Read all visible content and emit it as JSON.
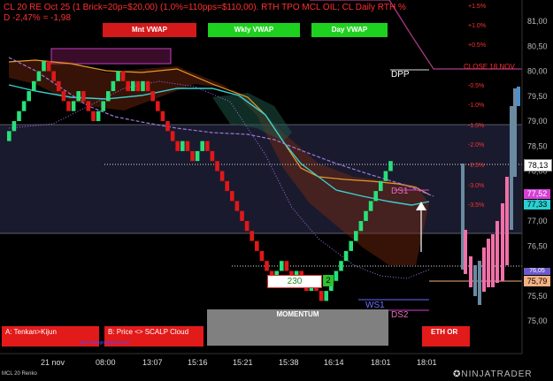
{
  "header": {
    "line1": "CL 20 RE Oct 25 (1 Brick=20p=$20,00)  (1,0%=110pps=$110,00). RTH TPO MCL OIL; CL Daily RTH %",
    "line2": "D -2,47% = -1,98"
  },
  "vwap_buttons": [
    {
      "label": "Mnt VWAP",
      "color": "#d31919"
    },
    {
      "label": "Wkly VWAP",
      "color": "#1ed11e"
    },
    {
      "label": "Day VWAP",
      "color": "#1ed11e"
    }
  ],
  "pct_labels": [
    "+1.5%",
    "+1.0%",
    "+0.5%",
    "-0.5%",
    "-1.0%",
    "-1.5%",
    "-2.0%",
    "-2.5%",
    "-3.0%",
    "-3.5%"
  ],
  "price_ticks": [
    "81,00",
    "80,50",
    "80,00",
    "79,50",
    "79,00",
    "78,50",
    "78,00",
    "77,50",
    "77,00",
    "76,50",
    "76,00",
    "75,50",
    "75,00"
  ],
  "price_flags": [
    {
      "label": "78,13",
      "bg": "#ffffff",
      "fg": "#000000"
    },
    {
      "label": "77,52",
      "bg": "#d63fd6",
      "fg": "#ffffff"
    },
    {
      "label": "77,33",
      "bg": "#29d1d1",
      "fg": "#000000"
    },
    {
      "label": "76,05",
      "bg": "#6a5acd",
      "fg": "#ffffff"
    },
    {
      "label": "75,79",
      "bg": "#f4b183",
      "fg": "#000000"
    }
  ],
  "levels": {
    "dpp": "DPP",
    "close": "CLOSE 18 NOV",
    "ds1": "DS1",
    "ws1": "WS1",
    "ds2": "DS2"
  },
  "counter": {
    "value": "230",
    "badge": "2"
  },
  "momentum_label": "MOMENTUM",
  "bottom_buttons": [
    {
      "label": "A: Tenkan>Kijun"
    },
    {
      "label": "B: Price <> SCALP Cloud"
    },
    {
      "label": "ETH OR"
    }
  ],
  "small_text": "Mail: bellogie@gmail.com",
  "x_ticks": [
    "21 nov",
    "08:00",
    "13:07",
    "15:16",
    "15:21",
    "15:38",
    "16:14",
    "18:01",
    "18:01"
  ],
  "footer": {
    "instrument": "MCL 20 Renko",
    "brand": "NINJATRADER"
  },
  "chart_data": {
    "type": "renko",
    "brick_size": 0.2,
    "ylim": [
      75.0,
      81.2
    ],
    "bricks": [
      {
        "o": 78.6,
        "c": 78.8
      },
      {
        "o": 78.8,
        "c": 79.0
      },
      {
        "o": 79.0,
        "c": 79.2
      },
      {
        "o": 79.2,
        "c": 79.4
      },
      {
        "o": 79.4,
        "c": 79.6
      },
      {
        "o": 79.6,
        "c": 79.8
      },
      {
        "o": 79.8,
        "c": 80.0
      },
      {
        "o": 80.0,
        "c": 80.2
      },
      {
        "o": 80.2,
        "c": 80.0
      },
      {
        "o": 80.0,
        "c": 79.8
      },
      {
        "o": 79.8,
        "c": 79.6
      },
      {
        "o": 79.6,
        "c": 79.4
      },
      {
        "o": 79.4,
        "c": 79.2
      },
      {
        "o": 79.2,
        "c": 79.4
      },
      {
        "o": 79.4,
        "c": 79.6
      },
      {
        "o": 79.6,
        "c": 79.4
      },
      {
        "o": 79.4,
        "c": 79.2
      },
      {
        "o": 79.2,
        "c": 79.0
      },
      {
        "o": 79.0,
        "c": 79.2
      },
      {
        "o": 79.2,
        "c": 79.4
      },
      {
        "o": 79.4,
        "c": 79.6
      },
      {
        "o": 79.6,
        "c": 79.8
      },
      {
        "o": 79.8,
        "c": 80.0
      },
      {
        "o": 80.0,
        "c": 79.8
      },
      {
        "o": 79.8,
        "c": 79.6
      },
      {
        "o": 79.6,
        "c": 79.8
      },
      {
        "o": 79.8,
        "c": 79.6
      },
      {
        "o": 79.6,
        "c": 79.8
      },
      {
        "o": 79.8,
        "c": 79.6
      },
      {
        "o": 79.6,
        "c": 79.4
      },
      {
        "o": 79.4,
        "c": 79.2
      },
      {
        "o": 79.2,
        "c": 79.0
      },
      {
        "o": 79.0,
        "c": 78.8
      },
      {
        "o": 78.8,
        "c": 78.6
      },
      {
        "o": 78.6,
        "c": 78.4
      },
      {
        "o": 78.4,
        "c": 78.6
      },
      {
        "o": 78.6,
        "c": 78.4
      },
      {
        "o": 78.4,
        "c": 78.2
      },
      {
        "o": 78.2,
        "c": 78.4
      },
      {
        "o": 78.4,
        "c": 78.6
      },
      {
        "o": 78.6,
        "c": 78.4
      },
      {
        "o": 78.4,
        "c": 78.2
      },
      {
        "o": 78.2,
        "c": 78.0
      },
      {
        "o": 78.0,
        "c": 77.8
      },
      {
        "o": 77.8,
        "c": 77.6
      },
      {
        "o": 77.6,
        "c": 77.4
      },
      {
        "o": 77.4,
        "c": 77.2
      },
      {
        "o": 77.2,
        "c": 77.0
      },
      {
        "o": 77.0,
        "c": 76.8
      },
      {
        "o": 76.8,
        "c": 76.6
      },
      {
        "o": 76.6,
        "c": 76.4
      },
      {
        "o": 76.4,
        "c": 76.2
      },
      {
        "o": 76.2,
        "c": 76.0
      },
      {
        "o": 76.0,
        "c": 75.8
      },
      {
        "o": 75.8,
        "c": 76.0
      },
      {
        "o": 76.0,
        "c": 76.2
      },
      {
        "o": 76.2,
        "c": 76.0
      },
      {
        "o": 76.0,
        "c": 75.8
      },
      {
        "o": 75.8,
        "c": 76.0
      },
      {
        "o": 76.0,
        "c": 75.8
      },
      {
        "o": 75.8,
        "c": 75.6
      },
      {
        "o": 75.6,
        "c": 75.8
      },
      {
        "o": 75.8,
        "c": 75.6
      },
      {
        "o": 75.6,
        "c": 75.4
      },
      {
        "o": 75.4,
        "c": 75.6
      },
      {
        "o": 75.6,
        "c": 75.8
      },
      {
        "o": 75.8,
        "c": 76.0
      },
      {
        "o": 76.0,
        "c": 76.2
      },
      {
        "o": 76.2,
        "c": 76.4
      },
      {
        "o": 76.4,
        "c": 76.6
      },
      {
        "o": 76.6,
        "c": 76.8
      },
      {
        "o": 76.8,
        "c": 77.0
      },
      {
        "o": 77.0,
        "c": 77.2
      },
      {
        "o": 77.2,
        "c": 77.4
      },
      {
        "o": 77.4,
        "c": 77.6
      },
      {
        "o": 77.6,
        "c": 77.8
      },
      {
        "o": 77.8,
        "c": 78.0
      },
      {
        "o": 78.0,
        "c": 78.2
      }
    ]
  }
}
